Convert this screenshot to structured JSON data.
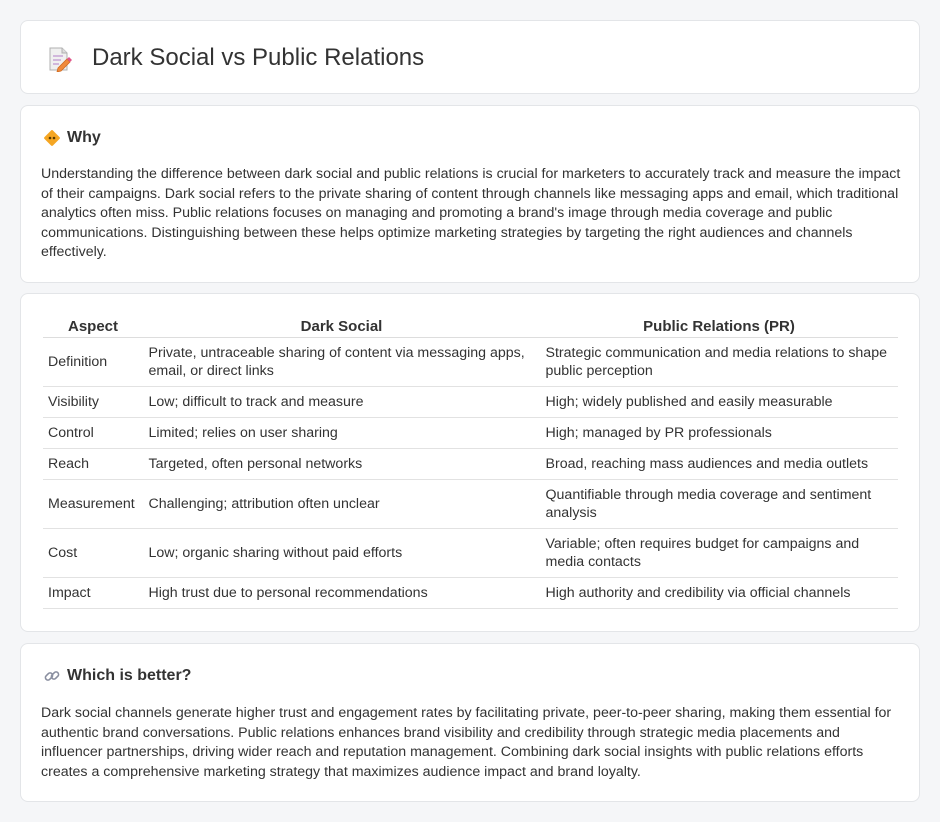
{
  "header": {
    "title": "Dark Social vs Public Relations",
    "icon": "document-pencil-icon"
  },
  "why": {
    "title": "Why",
    "icon": "diamond-sign-icon",
    "body": "Understanding the difference between dark social and public relations is crucial for marketers to accurately track and measure the impact of their campaigns. Dark social refers to the private sharing of content through channels like messaging apps and email, which traditional analytics often miss. Public relations focuses on managing and promoting a brand's image through media coverage and public communications. Distinguishing between these helps optimize marketing strategies by targeting the right audiences and channels effectively."
  },
  "table": {
    "headers": [
      "Aspect",
      "Dark Social",
      "Public Relations (PR)"
    ],
    "rows": [
      [
        "Definition",
        "Private, untraceable sharing of content via messaging apps, email, or direct links",
        "Strategic communication and media relations to shape public perception"
      ],
      [
        "Visibility",
        "Low; difficult to track and measure",
        "High; widely published and easily measurable"
      ],
      [
        "Control",
        "Limited; relies on user sharing",
        "High; managed by PR professionals"
      ],
      [
        "Reach",
        "Targeted, often personal networks",
        "Broad, reaching mass audiences and media outlets"
      ],
      [
        "Measurement",
        "Challenging; attribution often unclear",
        "Quantifiable through media coverage and sentiment analysis"
      ],
      [
        "Cost",
        "Low; organic sharing without paid efforts",
        "Variable; often requires budget for campaigns and media contacts"
      ],
      [
        "Impact",
        "High trust due to personal recommendations",
        "High authority and credibility via official channels"
      ]
    ]
  },
  "better": {
    "title": "Which is better?",
    "icon": "link-icon",
    "body": "Dark social channels generate higher trust and engagement rates by facilitating private, peer-to-peer sharing, making them essential for authentic brand conversations. Public relations enhances brand visibility and credibility through strategic media placements and influencer partnerships, driving wider reach and reputation management. Combining dark social insights with public relations efforts creates a comprehensive marketing strategy that maximizes audience impact and brand loyalty."
  }
}
